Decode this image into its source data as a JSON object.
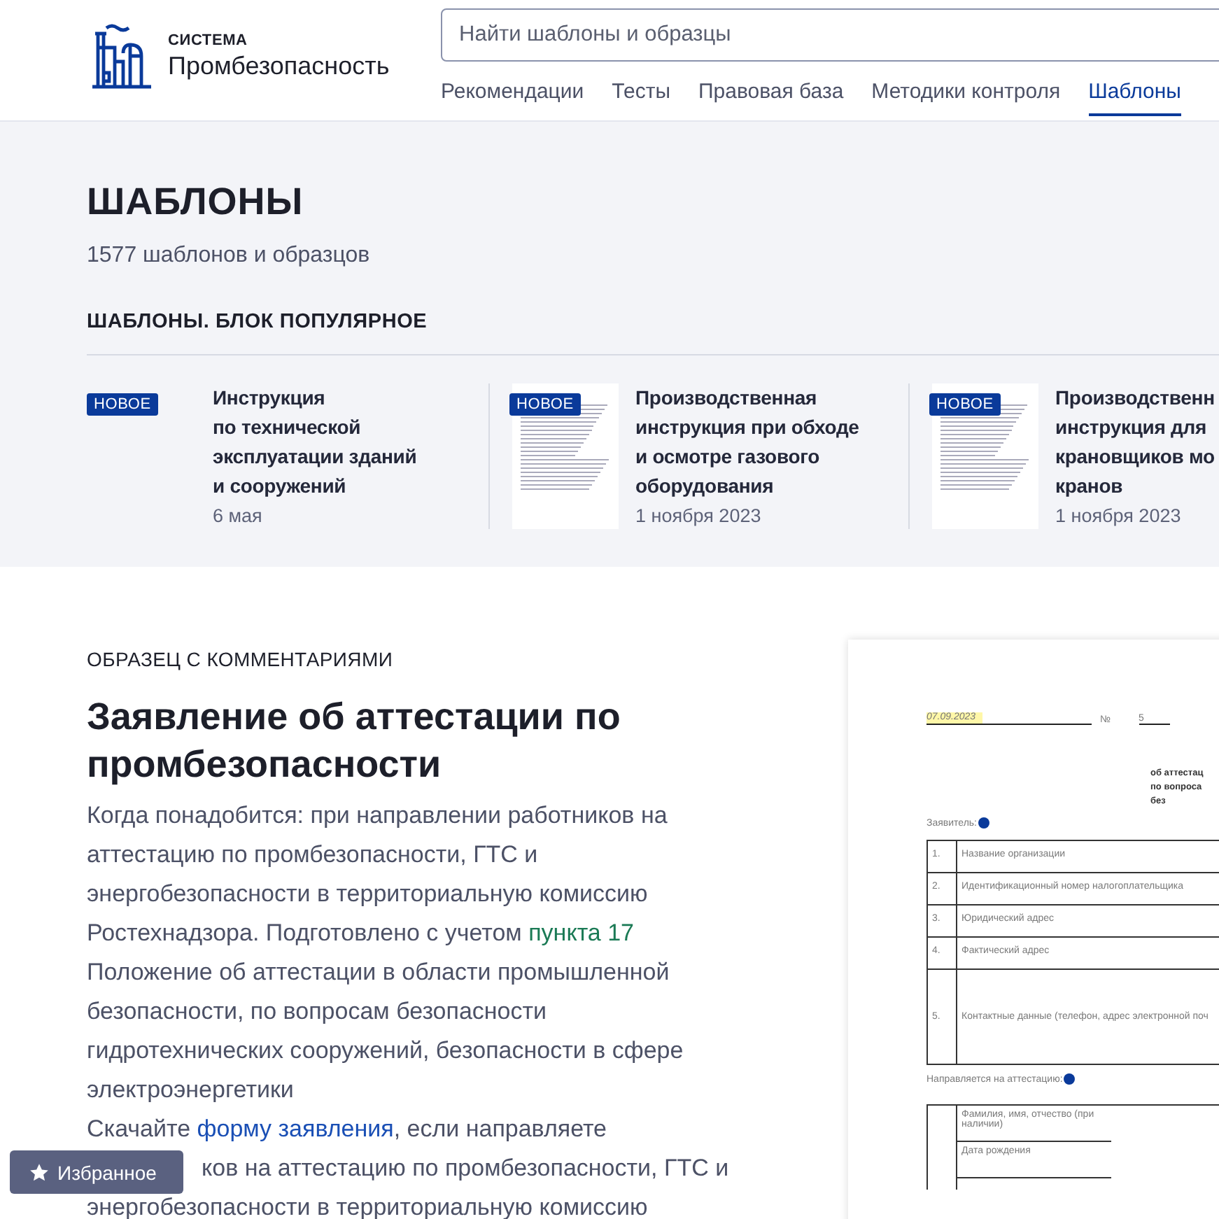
{
  "header": {
    "logo": {
      "kicker": "СИСТЕМА",
      "name": "Промбезопасность"
    },
    "search": {
      "placeholder": "Найти шаблоны и образцы"
    },
    "nav": [
      {
        "label": "Рекомендации",
        "selected": false
      },
      {
        "label": "Тесты",
        "selected": false
      },
      {
        "label": "Правовая база",
        "selected": false
      },
      {
        "label": "Методики контроля",
        "selected": false
      },
      {
        "label": "Шаблоны",
        "selected": true
      }
    ]
  },
  "intro": {
    "title": "ШАБЛОНЫ",
    "count": "1577 шаблонов и образцов",
    "section_title": "ШАБЛОНЫ. БЛОК ПОПУЛЯРНОЕ",
    "cards": [
      {
        "badge": "НОВОЕ",
        "has_preview": false,
        "title": "Инструкция\nпо технической\nэксплуатации зданий\nи сооружений",
        "date": "6 мая"
      },
      {
        "badge": "НОВОЕ",
        "has_preview": true,
        "title": "Производственная\nинструкция при обходе\nи осмотре газового\nоборудования",
        "date": "1 ноября 2023"
      },
      {
        "badge": "НОВОЕ",
        "has_preview": true,
        "title": "Производственн\nинструкция для\nкрановщиков мо\nкранов",
        "date": "1 ноября 2023"
      }
    ]
  },
  "article": {
    "eyebrow": "ОБРАЗЕЦ С КОММЕНТАРИЯМИ",
    "title": "Заявление об аттестации по промбезопасности",
    "paragraphs": [
      [
        {
          "kind": "text",
          "text": "Когда понадобится: при направлении работников на аттестацию по промбезопасности, ГТС и энергобезопасности в территориальную комиссию Ростехнадзора. Подготовлено с учетом "
        },
        {
          "kind": "link",
          "text": "пункта 17",
          "color": "#1b7a55"
        },
        {
          "kind": "text",
          "text": " Положение об аттестации в области промышленной безопасности, по вопросам безопасности гидротехнических сооружений, безопасности в сфере электроэнергетики"
        }
      ],
      [
        {
          "kind": "text",
          "text": "Скачайте "
        },
        {
          "kind": "link",
          "text": "форму заявления",
          "color": "#1a4fb5"
        },
        {
          "kind": "text",
          "text": ", если направляете"
        }
      ]
    ],
    "visible_lines": [
      "ков на аттестацию по промбезопасности, ГТС и",
      "энергобезопасности в территориальную комиссию"
    ]
  },
  "document": {
    "date": "07.09.2023",
    "number_sign": "№",
    "number": "5",
    "heading": [
      "об аттестац",
      "по вопроса",
      "без"
    ],
    "applicant_label": "Заявитель:",
    "applicant_rows": [
      {
        "num": "1.",
        "text": "Название организации",
        "tall": false
      },
      {
        "num": "2.",
        "text": "Идентификационный номер налогоплательщика",
        "tall": false
      },
      {
        "num": "3.",
        "text": "Юридический адрес",
        "tall": false
      },
      {
        "num": "4.",
        "text": "Фактический адрес",
        "tall": false
      },
      {
        "num": "5.",
        "text": "Контактные данные (телефон, адрес электронной поч",
        "tall": true
      }
    ],
    "employee_label": "Направляется на аттестацию:",
    "employee_rows": [
      {
        "text": "Фамилия, имя, отчество (при наличии)"
      },
      {
        "text": "Дата рождения"
      }
    ]
  },
  "favorites": {
    "label": "Избранное"
  }
}
